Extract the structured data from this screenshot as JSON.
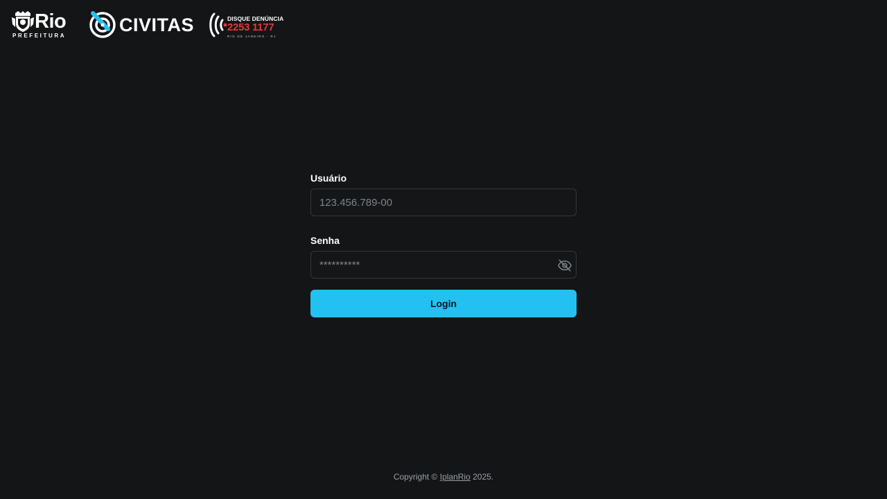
{
  "logos": {
    "rio": {
      "name": "Rio",
      "sub": "PREFEITURA"
    },
    "civitas": {
      "name": "CIVITAS",
      "accent": "#22c1f1"
    },
    "disque": {
      "title": "DISQUE DENÚNCIA",
      "number": "2253 1177",
      "sub": "RIO DE JANEIRO - RJ",
      "accent": "#e23a3a"
    }
  },
  "form": {
    "username": {
      "label": "Usuário",
      "placeholder": "123.456.789-00",
      "value": ""
    },
    "password": {
      "label": "Senha",
      "placeholder": "**********",
      "value": "",
      "toggle_icon": "eye-off-icon"
    },
    "submit_label": "Login"
  },
  "footer": {
    "prefix": "Copyright ©",
    "link": "IplanRio",
    "suffix": "2025."
  },
  "colors": {
    "background": "#141517",
    "primary": "#22c1f1",
    "input_border": "#34373b",
    "muted_text": "#9aa1a6"
  }
}
